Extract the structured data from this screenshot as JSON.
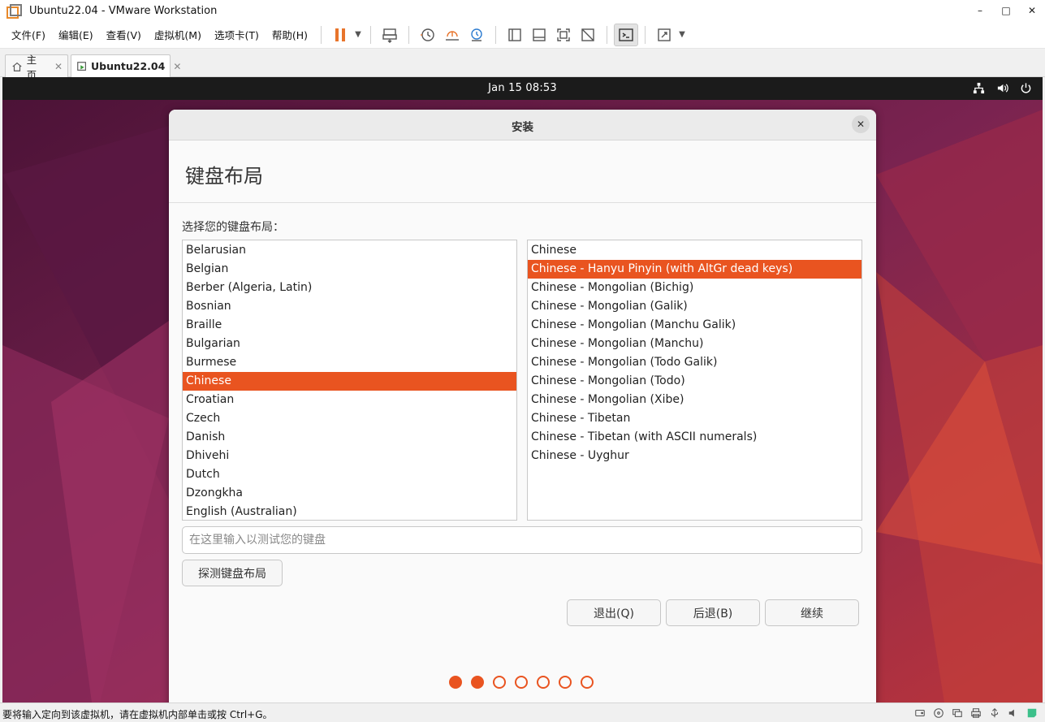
{
  "window": {
    "title": "Ubuntu22.04 - VMware Workstation"
  },
  "window_controls": {
    "minimize": "–",
    "maximize": "□",
    "close": "✕"
  },
  "menu": [
    "文件(F)",
    "编辑(E)",
    "查看(V)",
    "虚拟机(M)",
    "选项卡(T)",
    "帮助(H)"
  ],
  "tabs": [
    {
      "label": "主页",
      "close": "✕"
    },
    {
      "label": "Ubuntu22.04",
      "close": "✕"
    }
  ],
  "vm": {
    "clock": "Jan 15  08:53",
    "dialog": {
      "title": "安装",
      "close": "✕",
      "heading": "键盘布局",
      "list_label": "选择您的键盘布局：",
      "layouts": [
        "Belarusian",
        "Belgian",
        "Berber (Algeria, Latin)",
        "Bosnian",
        "Braille",
        "Bulgarian",
        "Burmese",
        "Chinese",
        "Croatian",
        "Czech",
        "Danish",
        "Dhivehi",
        "Dutch",
        "Dzongkha",
        "English (Australian)"
      ],
      "selected_layout": "Chinese",
      "variants": [
        "Chinese",
        "Chinese - Hanyu Pinyin (with AltGr dead keys)",
        "Chinese - Mongolian (Bichig)",
        "Chinese - Mongolian (Galik)",
        "Chinese - Mongolian (Manchu Galik)",
        "Chinese - Mongolian (Manchu)",
        "Chinese - Mongolian (Todo Galik)",
        "Chinese - Mongolian (Todo)",
        "Chinese - Mongolian (Xibe)",
        "Chinese - Tibetan",
        "Chinese - Tibetan (with ASCII numerals)",
        "Chinese - Uyghur"
      ],
      "selected_variant": "Chinese - Hanyu Pinyin (with AltGr dead keys)",
      "test_placeholder": "在这里输入以测试您的键盘",
      "test_value": "",
      "detect_button": "探测键盘布局",
      "quit_button": "退出(Q)",
      "back_button": "后退(B)",
      "continue_button": "继续",
      "progress": {
        "total_steps": 7,
        "completed_steps": 2
      }
    }
  },
  "statusbar": {
    "text": "要将输入定向到该虚拟机，请在虚拟机内部单击或按 Ctrl+G。"
  },
  "colors": {
    "accent": "#e95420",
    "ubuntu_topbar": "#1b1b1b",
    "vmware_orange": "#e8892b"
  }
}
